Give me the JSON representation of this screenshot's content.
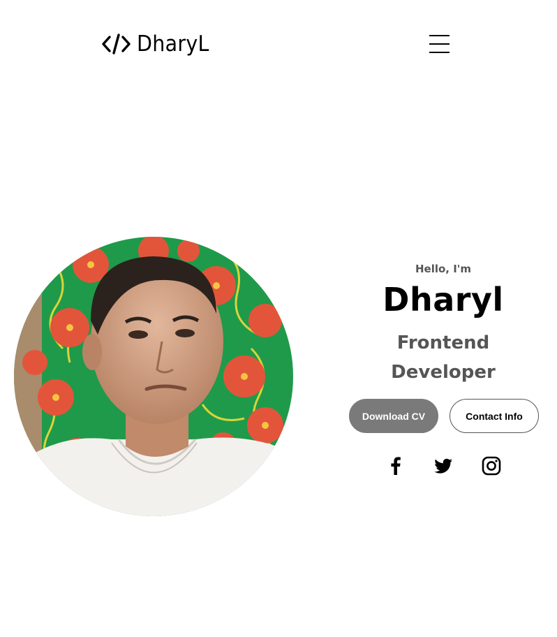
{
  "header": {
    "logo_text": "DharyL",
    "logo_icon": "code-slash-icon",
    "menu_icon": "hamburger-menu-icon"
  },
  "profile": {
    "photo_alt": "profile-photo"
  },
  "intro": {
    "greeting": "Hello, I'm",
    "name": "Dharyl",
    "role_line1": "Frontend",
    "role_line2": "Developer"
  },
  "buttons": {
    "download_cv": "Download CV",
    "contact_info": "Contact Info"
  },
  "social": {
    "facebook_icon": "facebook-icon",
    "twitter_icon": "twitter-icon",
    "instagram_icon": "instagram-icon"
  },
  "colors": {
    "primary_button_bg": "#7a7a7a",
    "text_dark": "#000000",
    "text_muted": "#555555",
    "background": "#ffffff"
  }
}
